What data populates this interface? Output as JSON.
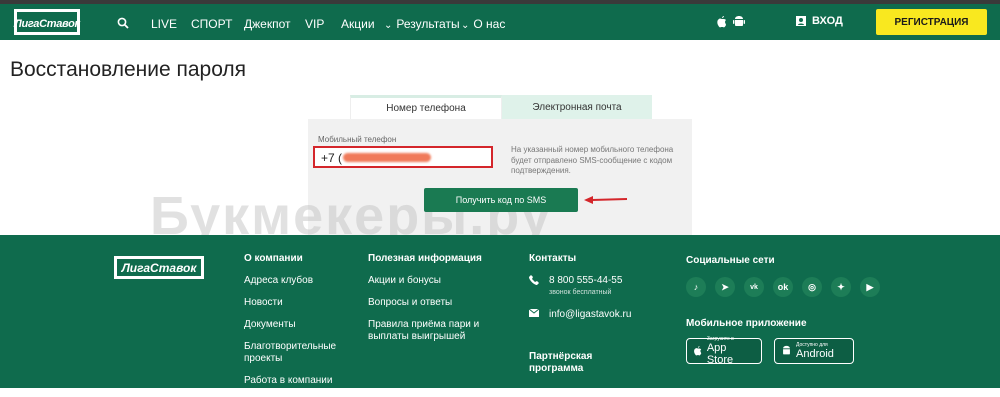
{
  "header": {
    "logo_text": "ЛигаСтавок",
    "nav": [
      "LIVE",
      "СПОРТ",
      "Джекпот",
      "VIP",
      "Акции"
    ],
    "nav_dropdowns": [
      "Результаты",
      "О нас"
    ],
    "login_label": "ВХОД",
    "register_label": "РЕГИСТРАЦИЯ"
  },
  "page": {
    "title": "Восстановление пароля",
    "tabs": [
      "Номер телефона",
      "Электронная почта"
    ],
    "phone_label": "Мобильный телефон",
    "phone_prefix": "+7 (",
    "hint": "На указанный номер мобильного телефона будет отправлено SMS-сообщение с кодом подтверждения.",
    "sms_button": "Получить код по SMS",
    "watermark": "Букмекеры.ру"
  },
  "footer": {
    "logo_text": "ЛигаСтавок",
    "col1": [
      "О компании",
      "Адреса клубов",
      "Новости",
      "Документы",
      "Благотворительные проекты",
      "Работа в компании"
    ],
    "col2": [
      "Полезная информация",
      "Акции и бонусы",
      "Вопросы и ответы",
      "Правила приёма пари и выплаты выигрышей"
    ],
    "contacts_title": "Контакты",
    "phone": "8 800 555-44-55",
    "phone_note": "звонок бесплатный",
    "email": "info@ligastavok.ru",
    "partner": "Партнёрская программа",
    "social_title": "Социальные сети",
    "social_icons": [
      "tiktok-icon",
      "telegram-icon",
      "vk-icon",
      "ok-icon",
      "instagram-icon",
      "twitter-icon",
      "youtube-icon"
    ],
    "mobile_title": "Мобильное приложение",
    "appstore_small": "Загрузите в",
    "appstore_big": "App Store",
    "android_small": "Доступно для",
    "android_big": "Android"
  },
  "colors": {
    "brand_green": "#0f6b4d",
    "accent_yellow": "#f9e81f",
    "highlight_red": "#d4262b"
  }
}
